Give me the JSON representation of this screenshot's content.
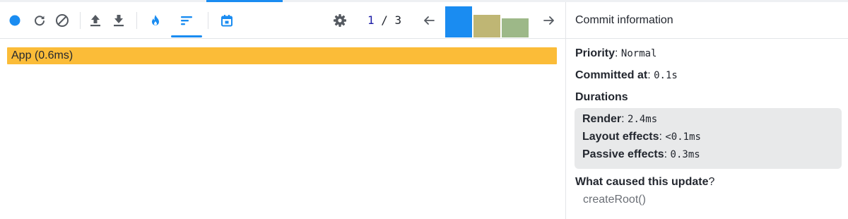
{
  "toolbar": {
    "buttons": [
      {
        "name": "record-icon",
        "color": "#1a8cf1"
      },
      {
        "name": "reload-icon"
      },
      {
        "name": "clear-icon"
      },
      {
        "name": "upload-icon"
      },
      {
        "name": "download-icon"
      },
      {
        "name": "flamegraph-icon",
        "color": "#1a8cf1"
      },
      {
        "name": "ranked-chart-icon",
        "color": "#1a8cf1",
        "selected": true
      },
      {
        "name": "timeline-icon",
        "color": "#1a8cf1"
      },
      {
        "name": "settings-icon"
      }
    ],
    "commit_index": "1",
    "commit_total": "3",
    "commit_separator": " / ",
    "commits": [
      {
        "level": 1.0,
        "color": "#1a8cf1",
        "selected": true
      },
      {
        "level": 0.72,
        "color": "#bfb674"
      },
      {
        "level": 0.62,
        "color": "#9db888"
      }
    ]
  },
  "flame": {
    "row_label": "App (0.6ms)",
    "row_color": "#fbbc38"
  },
  "sidebar": {
    "title": "Commit information",
    "priority_label": "Priority",
    "priority_value": "Normal",
    "committed_label": "Committed at",
    "committed_value": "0.1s",
    "durations_label": "Durations",
    "render_label": "Render",
    "render_value": "2.4ms",
    "layout_label": "Layout effects",
    "layout_value": "<0.1ms",
    "passive_label": "Passive effects",
    "passive_value": "0.3ms",
    "cause_label": "What caused this update",
    "cause_mark": "?",
    "cause_value": "createRoot()",
    "colon": ": "
  }
}
